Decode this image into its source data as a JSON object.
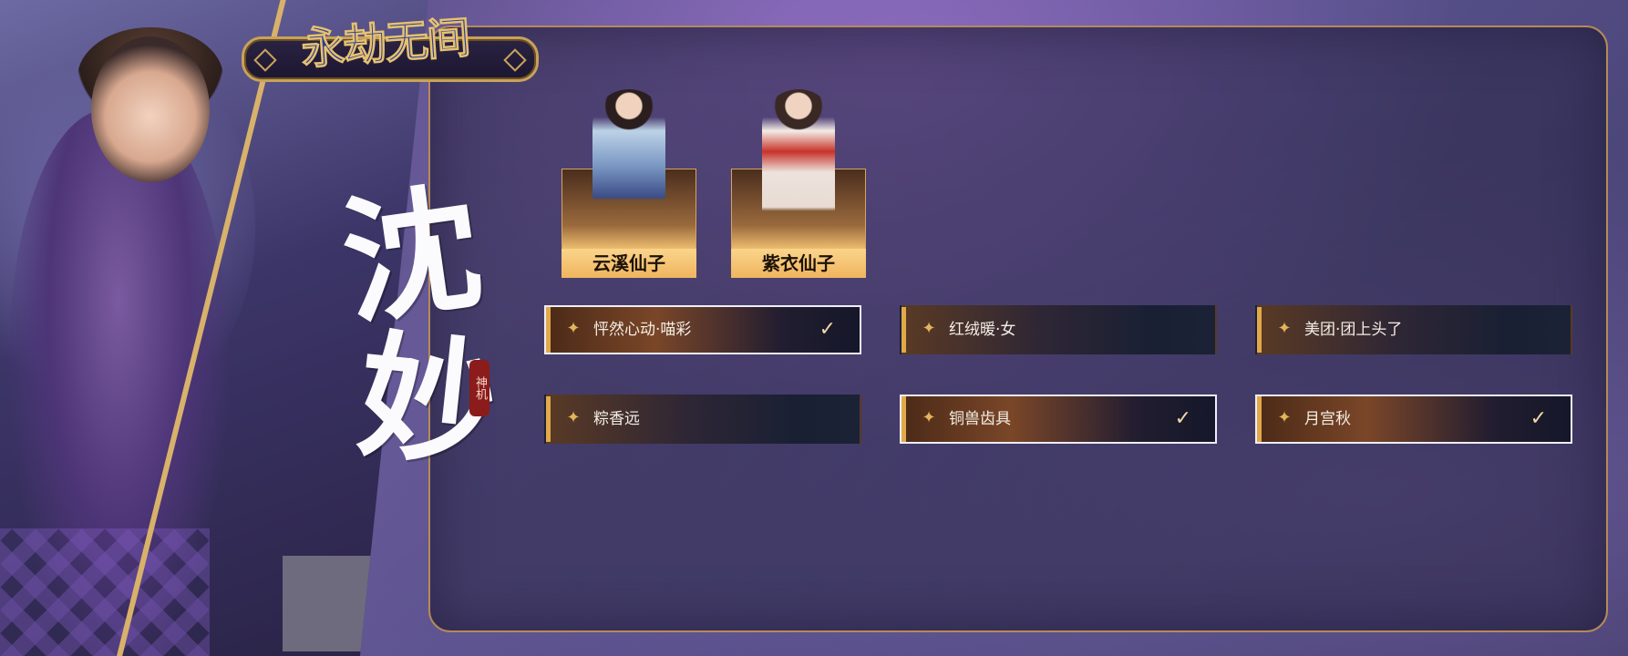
{
  "logo": {
    "text": "永劫无间"
  },
  "hero": {
    "title_chars": [
      "沈",
      "妙"
    ],
    "seal_text": "神机"
  },
  "characters": [
    {
      "name": "云溪仙子"
    },
    {
      "name": "紫衣仙子"
    }
  ],
  "items": [
    {
      "label": "怦然心动·喵彩",
      "selected": true
    },
    {
      "label": "红绒暖·女",
      "selected": false
    },
    {
      "label": "美团·团上头了",
      "selected": false
    },
    {
      "label": "粽香远",
      "selected": false
    },
    {
      "label": "铜兽齿具",
      "selected": true
    },
    {
      "label": "月宫秋",
      "selected": true
    }
  ],
  "check_symbol": "✓",
  "colors": {
    "accent": "#e2a94a",
    "panel_border": "#b5895a",
    "card_label_bg": "#fad48b"
  }
}
